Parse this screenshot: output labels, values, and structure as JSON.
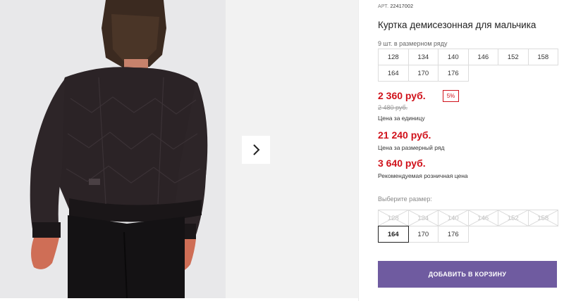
{
  "product": {
    "sku_label": "АРТ.",
    "sku": "22417002",
    "title": "Куртка демисезонная для мальчика",
    "set_count": "9 шт. в размерном ряду",
    "size_run": [
      "128",
      "134",
      "140",
      "146",
      "152",
      "158",
      "164",
      "170",
      "176"
    ]
  },
  "pricing": {
    "unit_price": "2 360 руб.",
    "discount": "5%",
    "old_price": "2 480 руб.",
    "unit_caption": "Цена за единицу",
    "set_price": "21 240 руб.",
    "set_caption": "Цена за размерный ряд",
    "rrp_price": "3 640 руб.",
    "rrp_caption": "Рекомендуемая розничная цена"
  },
  "size_picker": {
    "label": "Выберите размер:",
    "sizes": [
      {
        "value": "128",
        "available": false
      },
      {
        "value": "134",
        "available": false
      },
      {
        "value": "140",
        "available": false
      },
      {
        "value": "146",
        "available": false
      },
      {
        "value": "152",
        "available": false
      },
      {
        "value": "158",
        "available": false
      },
      {
        "value": "164",
        "available": true,
        "selected": true
      },
      {
        "value": "170",
        "available": true
      },
      {
        "value": "176",
        "available": true
      }
    ]
  },
  "actions": {
    "add_to_cart": "ДОБАВИТЬ В КОРЗИНУ"
  },
  "gallery": {
    "next_icon": "chevron-right-icon"
  },
  "colors": {
    "price_red": "#d0121b",
    "button_purple": "#6f5ba0"
  }
}
